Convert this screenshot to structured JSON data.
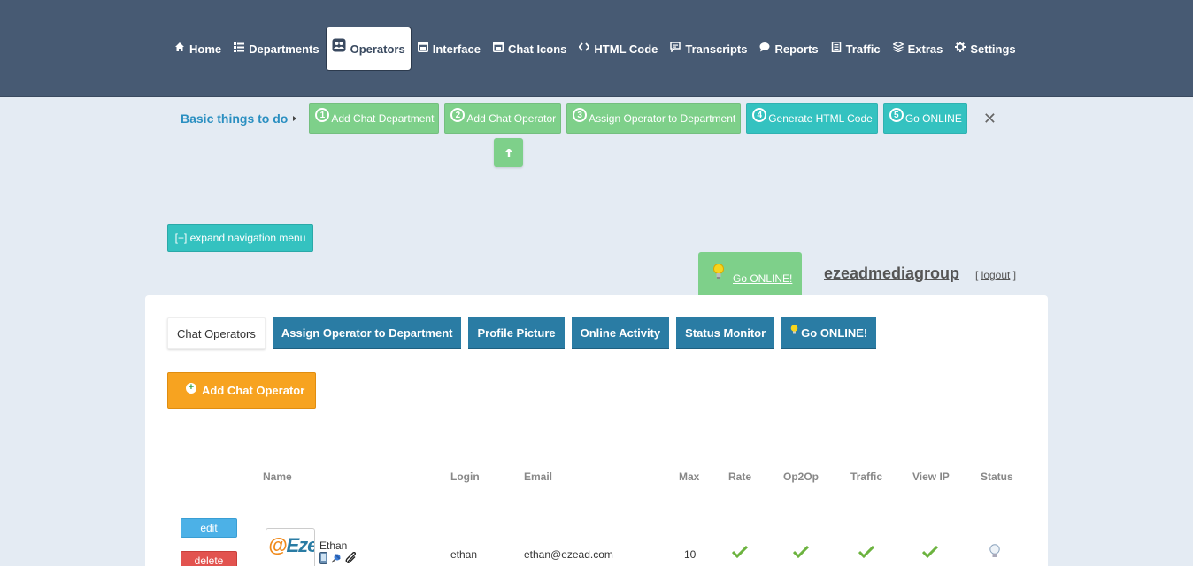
{
  "nav": {
    "items": [
      {
        "label": "Home",
        "icon": "home-icon"
      },
      {
        "label": "Departments",
        "icon": "list-icon"
      },
      {
        "label": "Operators",
        "icon": "users-icon",
        "active": true
      },
      {
        "label": "Interface",
        "icon": "window-icon"
      },
      {
        "label": "Chat Icons",
        "icon": "window-icon"
      },
      {
        "label": "HTML Code",
        "icon": "code-icon"
      },
      {
        "label": "Transcripts",
        "icon": "speech-icon"
      },
      {
        "label": "Reports",
        "icon": "bubble-icon"
      },
      {
        "label": "Traffic",
        "icon": "book-icon"
      },
      {
        "label": "Extras",
        "icon": "layers-icon"
      },
      {
        "label": "Settings",
        "icon": "gear-icon"
      }
    ]
  },
  "basics": {
    "label": "Basic things to do",
    "steps": [
      {
        "num": "1",
        "label": "Add Chat Department"
      },
      {
        "num": "2",
        "label": "Add Chat Operator"
      },
      {
        "num": "3",
        "label": "Assign Operator to Department"
      },
      {
        "num": "4",
        "label": "Generate HTML Code"
      },
      {
        "num": "5",
        "label": "Go ONLINE"
      }
    ],
    "close": "✕"
  },
  "expand_label": "[+] expand navigation menu",
  "go_online_label": "Go ONLINE!",
  "user": {
    "name": "ezeadmediagroup",
    "logout_prefix": "[ ",
    "logout": "logout",
    "logout_suffix": " ]"
  },
  "tabs": [
    {
      "label": "Chat Operators"
    },
    {
      "label": "Assign Operator to Department"
    },
    {
      "label": "Profile Picture"
    },
    {
      "label": "Online Activity"
    },
    {
      "label": "Status Monitor"
    },
    {
      "label": "Go ONLINE!"
    }
  ],
  "add_operator_label": "Add Chat Operator",
  "table": {
    "headers": [
      "Name",
      "Login",
      "Email",
      "Max",
      "Rate",
      "Op2Op",
      "Traffic",
      "View IP",
      "Status"
    ],
    "rows": [
      {
        "edit": "edit",
        "delete": "delete",
        "avatar_text_a": "",
        "avatar_text_b": "EzeAd",
        "name": "Ethan",
        "login": "ethan",
        "email": "ethan@ezead.com",
        "max": "10",
        "rate": true,
        "op2op": true,
        "traffic": true,
        "view_ip": true,
        "status": "offline"
      }
    ]
  },
  "colors": {
    "topbar": "#475a73",
    "step_green": "#7ed08a",
    "step_teal": "#34c2c0",
    "tab_blue": "#2a7ca4",
    "add_orange": "#f7a320",
    "edit_blue": "#4cb1e7",
    "delete_red": "#e2534f",
    "basics_label": "#2a8fc1"
  }
}
